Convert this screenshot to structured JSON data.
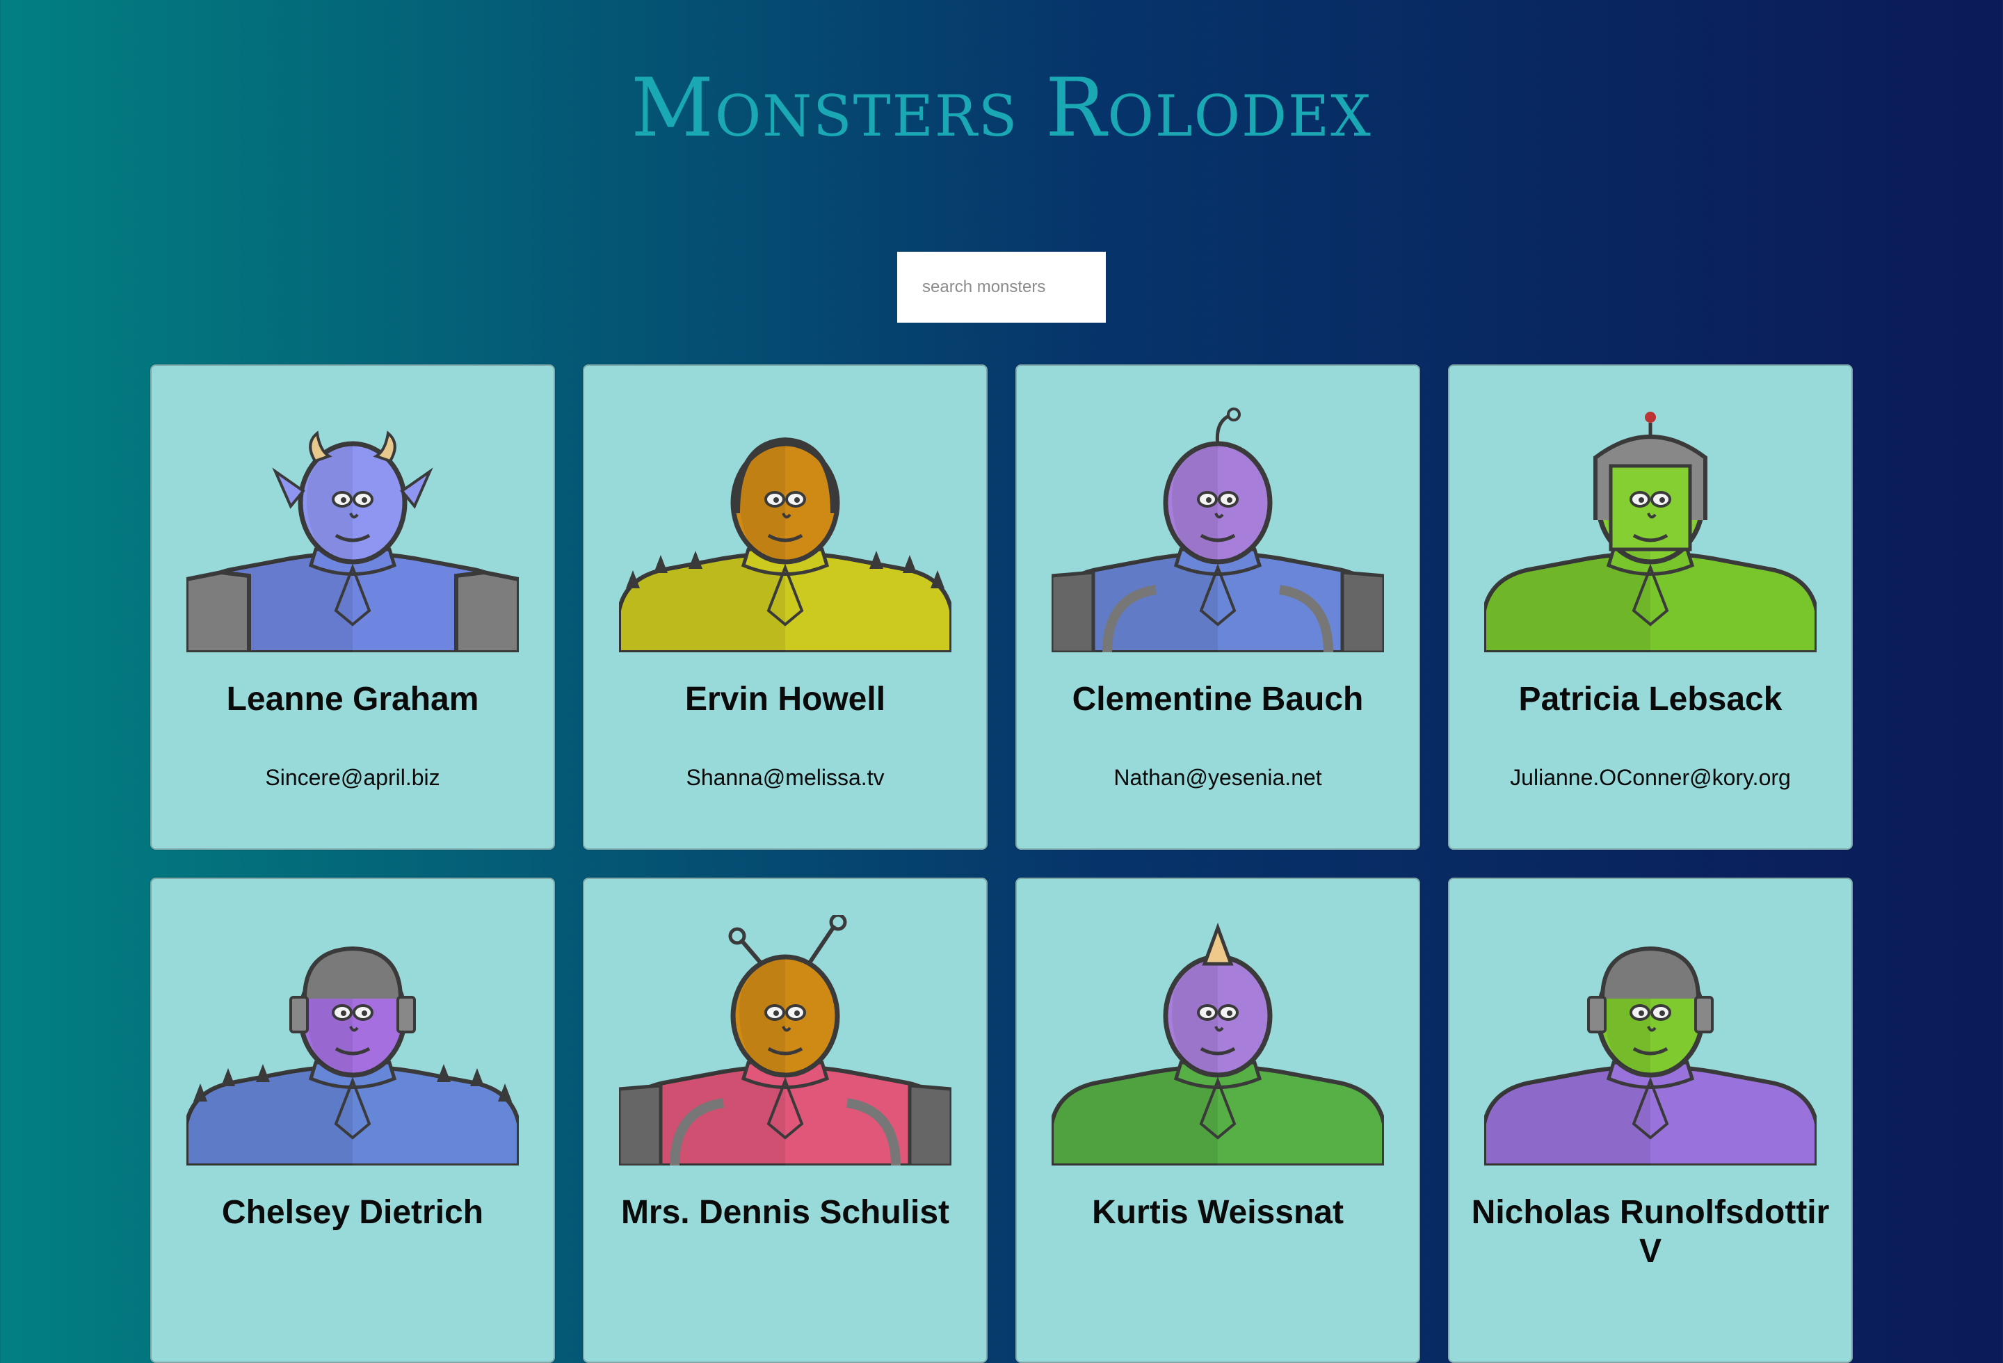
{
  "header": {
    "title": "Monsters Rolodex"
  },
  "search": {
    "placeholder": "search monsters",
    "value": ""
  },
  "monsters": [
    {
      "name": "Leanne Graham",
      "email": "Sincere@april.biz",
      "body_color": "#6f86e0",
      "head_color": "#8e96f2",
      "head_icon": "horns-icon",
      "shoulder": "armor"
    },
    {
      "name": "Ervin Howell",
      "email": "Shanna@melissa.tv",
      "body_color": "#cdca1f",
      "head_color": "#cf8a16",
      "head_icon": "helmet-icon",
      "shoulder": "spikes"
    },
    {
      "name": "Clementine Bauch",
      "email": "Nathan@yesenia.net",
      "body_color": "#6a86d8",
      "head_color": "#a77ed9",
      "head_icon": "antenna-icon",
      "shoulder": "pipes"
    },
    {
      "name": "Patricia Lebsack",
      "email": "Julianne.OConner@kory.org",
      "body_color": "#79c62c",
      "head_color": "#85cf33",
      "head_icon": "knight-helmet-icon",
      "shoulder": "round"
    },
    {
      "name": "Chelsey Dietrich",
      "email": "",
      "body_color": "#6686d8",
      "head_color": "#a56fe0",
      "head_icon": "robot-helmet-icon",
      "shoulder": "spikes"
    },
    {
      "name": "Mrs. Dennis Schulist",
      "email": "",
      "body_color": "#e1577a",
      "head_color": "#cf8a16",
      "head_icon": "antennae-icon",
      "shoulder": "pipes"
    },
    {
      "name": "Kurtis Weissnat",
      "email": "",
      "body_color": "#56b045",
      "head_color": "#a77ed9",
      "head_icon": "horn-icon",
      "shoulder": "round"
    },
    {
      "name": "Nicholas Runolfsdottir V",
      "email": "",
      "body_color": "#9a72dc",
      "head_color": "#7fca2e",
      "head_icon": "robot-helmet-icon",
      "shoulder": "round"
    }
  ]
}
